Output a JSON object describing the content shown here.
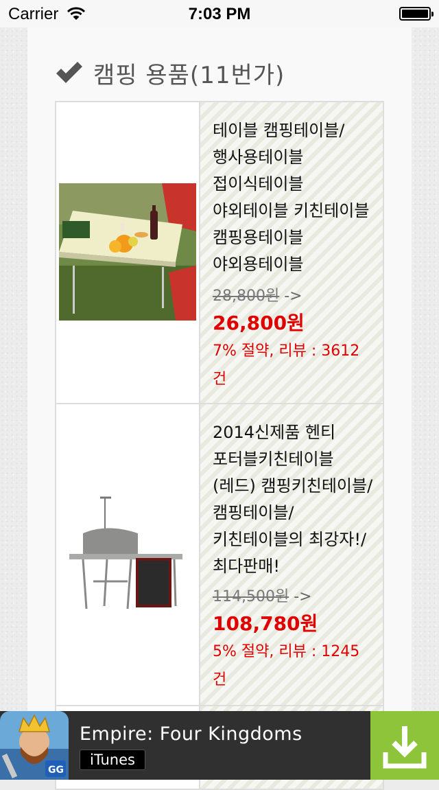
{
  "status_bar": {
    "carrier": "Carrier",
    "time": "7:03 PM"
  },
  "section": {
    "icon": "check-icon",
    "title": "캠핑 용품(11번가)"
  },
  "products": [
    {
      "title": "테이블 캠핑테이블/행사용테이블 접이식테이블 야외테이블 키친테이블 캠핑용테이블 야외용테이블",
      "original_price": "28,800원",
      "arrow": "->",
      "price": "26,800원",
      "meta": "7% 절약, 리뷰 : 3612건",
      "image": "folding-camping-table-photo"
    },
    {
      "title": "2014신제품 헨티 포터블키친테이블(레드) 캠핑키친테이블/캠핑테이블/키친테이블의 최강자!/최다판매!",
      "original_price": "114,500원",
      "arrow": "->",
      "price": "108,780원",
      "meta": "5% 절약, 리뷰 : 1245건",
      "image": "portable-kitchen-table-photo"
    }
  ],
  "ad": {
    "title": "Empire: Four Kingdoms",
    "store": "iTunes",
    "icon": "game-king-icon",
    "action_icon": "download-icon"
  },
  "colors": {
    "price": "#e00000",
    "ad_background": "#303030",
    "ad_action": "#8ec43a"
  }
}
